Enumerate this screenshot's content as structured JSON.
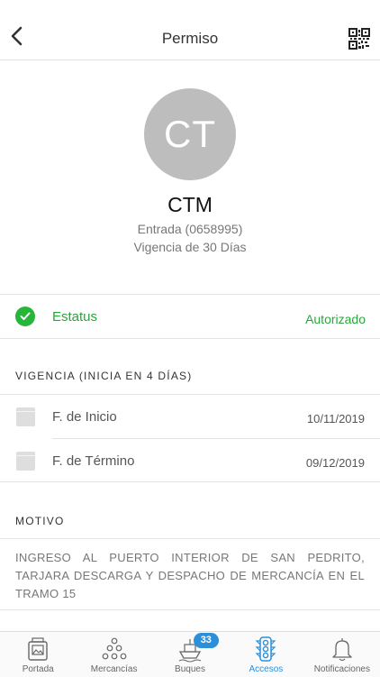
{
  "nav": {
    "title": "Permiso"
  },
  "profile": {
    "initials": "CT",
    "name": "CTM",
    "entry": "Entrada (0658995)",
    "validity": "Vigencia de 30 Días"
  },
  "status": {
    "label": "Estatus",
    "value": "Autorizado"
  },
  "vigencia": {
    "header": "VIGENCIA (INICIA EN 4 DÍAS)",
    "rows": [
      {
        "label": "F. de Inicio",
        "value": "10/11/2019"
      },
      {
        "label": "F. de Término",
        "value": "09/12/2019"
      }
    ]
  },
  "motivo": {
    "header": "MOTIVO",
    "text": "INGRESO AL PUERTO INTERIOR DE SAN PEDRITO, TARJARA DESCARGA Y DESPACHO DE MERCANCÍA EN EL TRAMO 15"
  },
  "tabs": [
    {
      "label": "Portada",
      "icon": "portada-icon"
    },
    {
      "label": "Mercancías",
      "icon": "mercancias-icon"
    },
    {
      "label": "Buques",
      "icon": "ship-icon",
      "badge": "33"
    },
    {
      "label": "Accesos",
      "icon": "traffic-light-icon",
      "active": true
    },
    {
      "label": "Notificaciones",
      "icon": "bell-icon"
    }
  ],
  "colors": {
    "accent": "#2d8fd8",
    "success": "#27b53a",
    "avatar": "#bdbdbd"
  }
}
